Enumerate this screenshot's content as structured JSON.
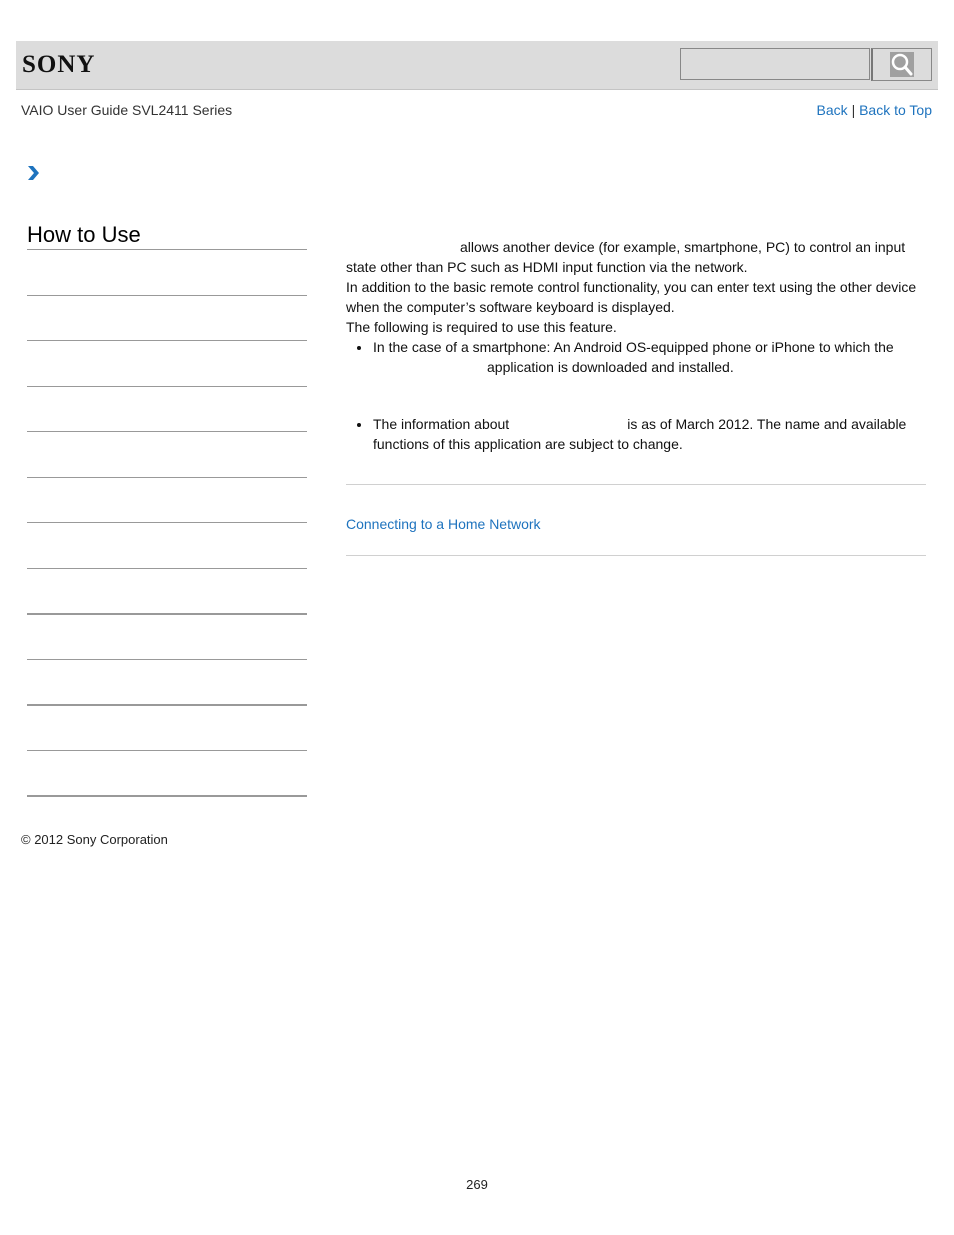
{
  "header": {
    "logo": "SONY",
    "search_placeholder": "",
    "search_icon": "magnifier-icon"
  },
  "guide_title": "VAIO User Guide SVL2411 Series",
  "nav_links": {
    "back": "Back",
    "separator": "|",
    "back_to_top": "Back to Top"
  },
  "breadcrumb_icon": "chevron-right-icon",
  "sidebar": {
    "heading": "How to Use",
    "item_count": 12
  },
  "content": {
    "p1_line1": "allows another device (for example, smartphone, PC) to control an input",
    "p1_line2": "state other than PC such as HDMI input function via the network.",
    "p2_line1": "In addition to the basic remote control functionality, you can enter text using the other device",
    "p2_line2": "when the computer’s software keyboard is displayed.",
    "p3": "The following is required to use this feature.",
    "bullet1_line1": "In the case of a smartphone: An Android OS-equipped phone or iPhone to which the",
    "bullet1_line2": "application is downloaded and installed.",
    "note_line1_a": "The information about",
    "note_line1_b": "is as of March 2012. The name and available",
    "note_line2": "functions of this application are subject to change."
  },
  "related": {
    "link": "Connecting to a Home Network"
  },
  "footer": {
    "copyright": "© 2012 Sony Corporation",
    "page_number": "269"
  },
  "colors": {
    "link": "#1e73be",
    "header_bg": "#dcdcdc",
    "chevron": "#1e73be"
  }
}
